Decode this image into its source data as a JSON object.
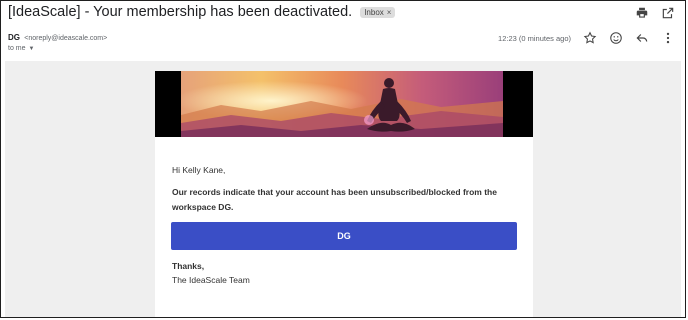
{
  "email": {
    "subject": "[IdeaScale] - Your membership has been deactivated.",
    "label": "Inbox",
    "label_close": "×",
    "sender_name": "DG",
    "sender_address": "<noreply@ideascale.com>",
    "recipient": "to me",
    "time": "12:23 (0 minutes ago)"
  },
  "icons": {
    "print": "print-icon",
    "open_new": "open-in-new-icon",
    "star": "star-icon",
    "emoji": "emoji-icon",
    "reply": "reply-icon",
    "more": "more-vert-icon"
  },
  "body": {
    "greeting": "Hi Kelly Kane,",
    "records_text": "Our records indicate that your account has been unsubscribed/blocked from the workspace DG.",
    "button_label": "DG",
    "thanks": "Thanks,",
    "signature": "The IdeaScale Team"
  },
  "colors": {
    "button": "#3a4ec6",
    "canvas": "#efefef"
  }
}
